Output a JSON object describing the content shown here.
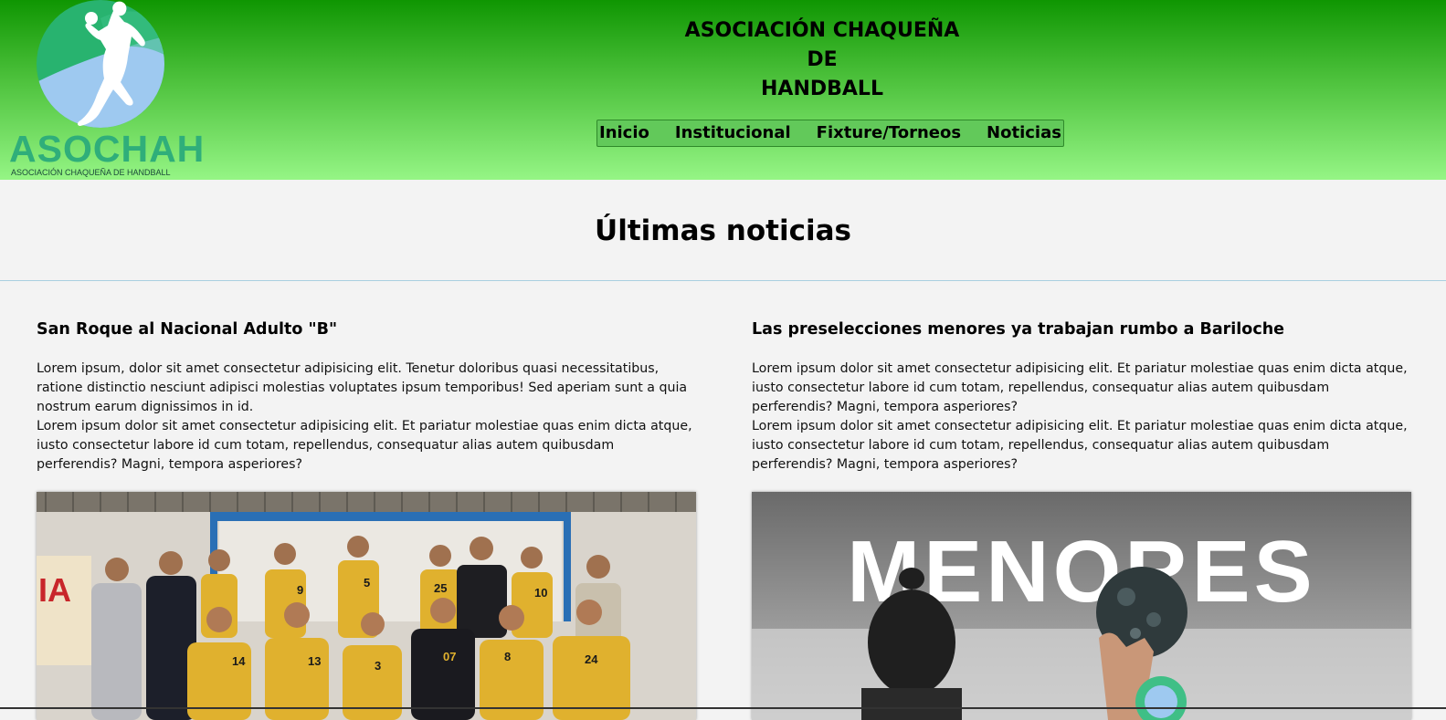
{
  "header": {
    "logo_word": "ASOCHAH",
    "logo_subtitle": "ASOCIACIÓN CHAQUEÑA DE HANDBALL",
    "title_lines": [
      "ASOCIACIÓN CHAQUEÑA",
      "DE",
      "HANDBALL"
    ],
    "nav": [
      "Inicio",
      "Institucional",
      "Fixture/Torneos",
      "Noticias"
    ]
  },
  "section": {
    "title": "Últimas noticias"
  },
  "news": [
    {
      "title": "San Roque al Nacional Adulto \"B\"",
      "paragraphs": [
        "Lorem ipsum, dolor sit amet consectetur adipisicing elit. Tenetur doloribus quasi necessitatibus, ratione distinctio nesciunt adipisci molestias voluptates ipsum temporibus! Sed aperiam sunt a quia nostrum earum dignissimos in id.",
        "Lorem ipsum dolor sit amet consectetur adipisicing elit. Et pariatur molestiae quas enim dicta atque, iusto consectetur labore id cum totam, repellendus, consequatur alias autem quibusdam perferendis? Magni, tempora asperiores?"
      ],
      "image": "team-photo"
    },
    {
      "title": "Las preselecciones menores ya trabajan rumbo a Bariloche",
      "paragraphs": [
        "Lorem ipsum dolor sit amet consectetur adipisicing elit. Et pariatur molestiae quas enim dicta atque, iusto consectetur labore id cum totam, repellendus, consequatur alias autem quibusdam perferendis? Magni, tempora asperiores?",
        "Lorem ipsum dolor sit amet consectetur adipisicing elit. Et pariatur molestiae quas enim dicta atque, iusto consectetur labore id cum totam, repellendus, consequatur alias autem quibusdam perferendis? Magni, tempora asperiores?"
      ],
      "image_text": "MENORES",
      "image": "menores-photo"
    }
  ],
  "colors": {
    "header_top": "#0f9602",
    "header_bottom": "#95f585",
    "logo_green": "#2fae7a",
    "jersey_yellow": "#e0b12e"
  }
}
